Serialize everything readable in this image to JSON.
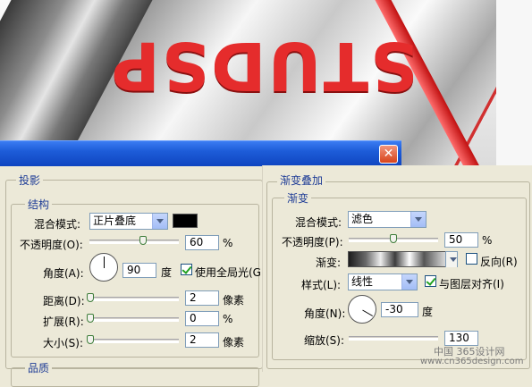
{
  "canvas": {
    "logo_text": "STUDSP"
  },
  "window": {
    "close_glyph": "✕"
  },
  "drop_shadow": {
    "section_title": "投影",
    "structure_title": "结构",
    "blend_mode_label": "混合模式:",
    "blend_mode_value": "正片叠底",
    "shadow_color": "#000000",
    "opacity_label": "不透明度(O):",
    "opacity_value": "60",
    "opacity_unit": "%",
    "angle_label": "角度(A):",
    "angle_value": "90",
    "angle_unit": "度",
    "global_light_label": "使用全局光(G",
    "global_light_checked": true,
    "distance_label": "距离(D):",
    "distance_value": "2",
    "distance_unit": "像素",
    "spread_label": "扩展(R):",
    "spread_value": "0",
    "spread_unit": "%",
    "size_label": "大小(S):",
    "size_value": "2",
    "size_unit": "像素",
    "quality_title": "品质"
  },
  "gradient_overlay": {
    "section_title": "渐变叠加",
    "gradient_title": "渐变",
    "blend_mode_label": "混合模式:",
    "blend_mode_value": "滤色",
    "opacity_label": "不透明度(P):",
    "opacity_value": "50",
    "opacity_unit": "%",
    "gradient_label": "渐变:",
    "reverse_label": "反向(R)",
    "reverse_checked": false,
    "style_label": "样式(L):",
    "style_value": "线性",
    "align_layer_label": "与图层对齐(I)",
    "align_layer_checked": true,
    "angle_label": "角度(N):",
    "angle_value": "-30",
    "angle_unit": "度",
    "scale_label": "缩放(S):",
    "scale_value": "130"
  },
  "watermark": {
    "line1": "中国 365设计网",
    "line2": "www.cn365design.com"
  }
}
